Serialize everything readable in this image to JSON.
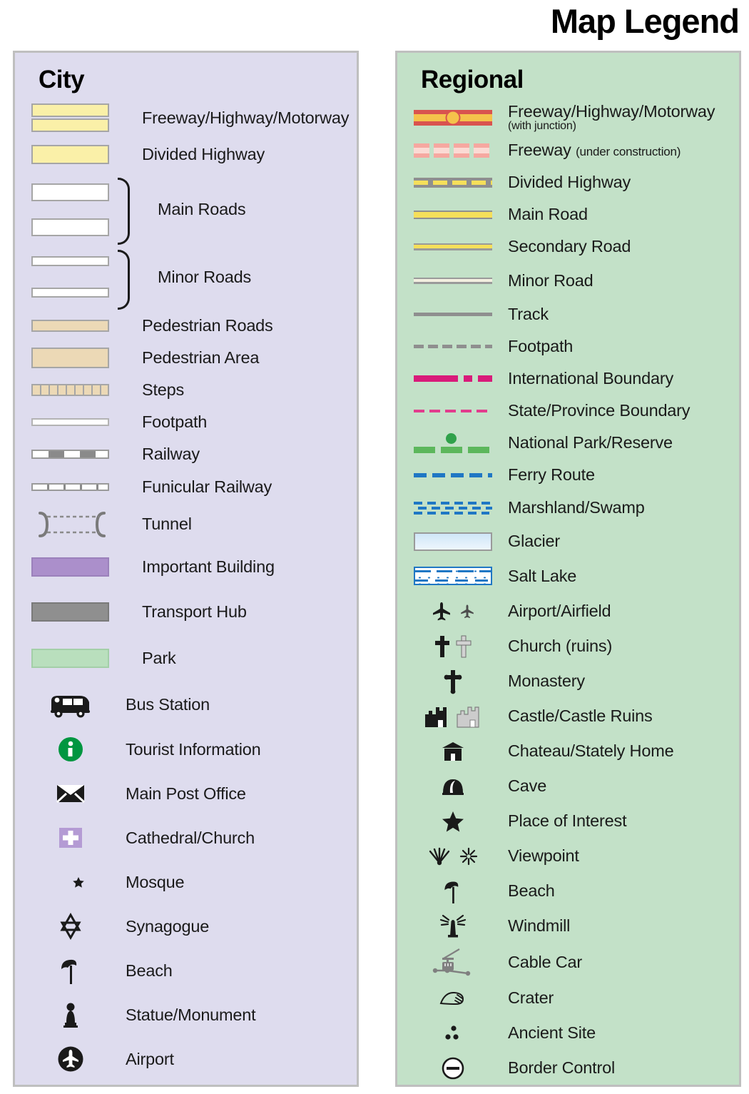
{
  "title": "Map Legend",
  "city": {
    "heading": "City",
    "background": "#dedcee",
    "items": [
      {
        "label": "Freeway/Highway/Motorway",
        "symbol": "freeway-double-yellow-bar"
      },
      {
        "label": "Divided Highway",
        "symbol": "single-yellow-bar"
      },
      {
        "label": "Main Roads",
        "symbol": "two-white-bars-braced"
      },
      {
        "label": "Minor Roads",
        "symbol": "two-thin-white-bars-braced"
      },
      {
        "label": "Pedestrian Roads",
        "symbol": "tan-thin-bar"
      },
      {
        "label": "Pedestrian Area",
        "symbol": "tan-filled-bar"
      },
      {
        "label": "Steps",
        "symbol": "steps-hatched-bar"
      },
      {
        "label": "Footpath",
        "symbol": "white-hairline-bar"
      },
      {
        "label": "Railway",
        "symbol": "railway-dash-bar"
      },
      {
        "label": "Funicular Railway",
        "symbol": "funicular-ticked-bar"
      },
      {
        "label": "Tunnel",
        "symbol": "tunnel-bracket-dashed"
      },
      {
        "label": "Important Building",
        "symbol": "purple-filled-bar"
      },
      {
        "label": "Transport Hub",
        "symbol": "grey-filled-bar"
      },
      {
        "label": "Park",
        "symbol": "green-filled-bar"
      },
      {
        "label": "Bus Station",
        "symbol": "bus-icon"
      },
      {
        "label": "Tourist Information",
        "symbol": "information-circle-icon"
      },
      {
        "label": "Main Post Office",
        "symbol": "envelope-icon"
      },
      {
        "label": "Cathedral/Church",
        "symbol": "cross-on-purple-square-icon"
      },
      {
        "label": "Mosque",
        "symbol": "crescent-star-icon"
      },
      {
        "label": "Synagogue",
        "symbol": "star-of-david-icon"
      },
      {
        "label": "Beach",
        "symbol": "beach-umbrella-icon"
      },
      {
        "label": "Statue/Monument",
        "symbol": "statue-icon"
      },
      {
        "label": "Airport",
        "symbol": "airplane-circle-icon"
      }
    ]
  },
  "regional": {
    "heading": "Regional",
    "background": "#c3e1c8",
    "items": [
      {
        "label": "Freeway/Highway/Motorway",
        "sublabel": "(with junction)",
        "symbol": "freeway-red-yellow-with-junction-dot"
      },
      {
        "label": "Freeway",
        "sublabel_inline": "(under construction)",
        "symbol": "pink-dashed-freeway"
      },
      {
        "label": "Divided Highway",
        "symbol": "grey-yellow-dashed-line"
      },
      {
        "label": "Main Road",
        "symbol": "yellow-thick-line"
      },
      {
        "label": "Secondary Road",
        "symbol": "yellow-thin-line"
      },
      {
        "label": "Minor Road",
        "symbol": "cream-hairline"
      },
      {
        "label": "Track",
        "symbol": "grey-solid-line"
      },
      {
        "label": "Footpath",
        "symbol": "grey-dashed-line"
      },
      {
        "label": "International Boundary",
        "symbol": "magenta-dash-dot-line"
      },
      {
        "label": "State/Province Boundary",
        "symbol": "pink-dashed-line"
      },
      {
        "label": "National Park/Reserve",
        "symbol": "green-dashed-line-with-dot"
      },
      {
        "label": "Ferry Route",
        "symbol": "blue-dashed-line"
      },
      {
        "label": "Marshland/Swamp",
        "symbol": "blue-marsh-hatch"
      },
      {
        "label": "Glacier",
        "symbol": "light-blue-gradient-box"
      },
      {
        "label": "Salt Lake",
        "symbol": "blue-dotted-box"
      },
      {
        "label": "Airport/Airfield",
        "symbol": "airplane-pair-icon"
      },
      {
        "label": "Church (ruins)",
        "symbol": "cross-pair-icon"
      },
      {
        "label": "Monastery",
        "symbol": "orthodox-cross-icon"
      },
      {
        "label": "Castle/Castle Ruins",
        "symbol": "castle-pair-icon"
      },
      {
        "label": "Chateau/Stately Home",
        "symbol": "chateau-icon"
      },
      {
        "label": "Cave",
        "symbol": "cave-icon"
      },
      {
        "label": "Place of Interest",
        "symbol": "star-icon"
      },
      {
        "label": "Viewpoint",
        "symbol": "viewpoint-pair-icon"
      },
      {
        "label": "Beach",
        "symbol": "beach-umbrella-icon"
      },
      {
        "label": "Windmill",
        "symbol": "windmill-icon"
      },
      {
        "label": "Cable Car",
        "symbol": "cable-car-icon"
      },
      {
        "label": "Crater",
        "symbol": "crater-icon"
      },
      {
        "label": "Ancient Site",
        "symbol": "ancient-site-dots-icon"
      },
      {
        "label": "Border Control",
        "symbol": "border-control-circle-icon"
      }
    ]
  },
  "colors": {
    "city_panel": "#dedcee",
    "regional_panel": "#c3e1c8",
    "panel_border": "#bfbfbf",
    "road_yellow": "#faf0a8",
    "freeway_red": "#d9534f",
    "freeway_yellow": "#f5c24b",
    "construction_pink": "#f6a8a0",
    "pedestrian_tan": "#ecd9b6",
    "important_building_purple": "#ab8fcb",
    "transport_hub_grey": "#8f8f8f",
    "park_green": "#b9dfbd",
    "boundary_magenta": "#d81b7a",
    "state_boundary_pink": "#e23c8d",
    "national_park_green": "#5cb75c",
    "ferry_blue": "#1f77c4",
    "glacier_blue": "#cfe6f7",
    "info_green": "#009640"
  }
}
